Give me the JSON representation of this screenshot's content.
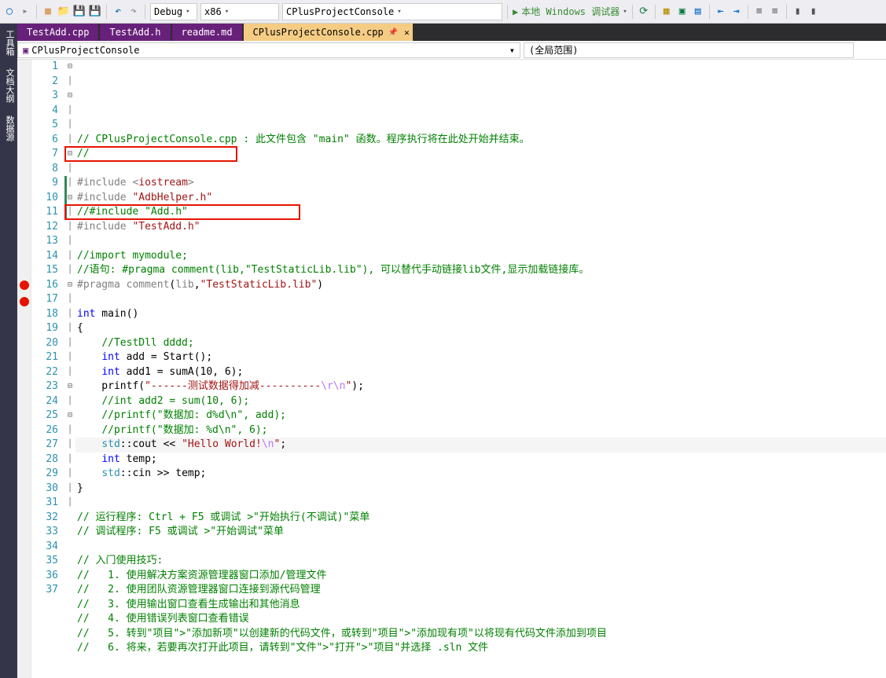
{
  "toolbar": {
    "config": "Debug",
    "platform": "x86",
    "startup": "CPlusProjectConsole",
    "run_label": "本地 Windows 调试器"
  },
  "tabs": [
    {
      "label": "TestAdd.cpp"
    },
    {
      "label": "TestAdd.h"
    },
    {
      "label": "readme.md"
    },
    {
      "label": "CPlusProjectConsole.cpp",
      "active": true
    }
  ],
  "crumb": {
    "file": "CPlusProjectConsole",
    "scope": "(全局范围)"
  },
  "side_tabs": [
    "工具箱",
    "文档大纲",
    "数据源"
  ],
  "lines": [
    {
      "n": 1,
      "fold": "-",
      "html": "<span class='c-comment'>// CPlusProjectConsole.cpp : 此文件包含 \"main\" 函数。程序执行将在此处开始并结束。</span>"
    },
    {
      "n": 2,
      "fold": "|",
      "html": "<span class='c-comment'>//</span>"
    },
    {
      "n": 3,
      "fold": "",
      "html": ""
    },
    {
      "n": 4,
      "fold": "-",
      "html": "<span class='c-grey'>#include</span> <span class='c-grey'>&lt;</span><span class='c-string'>iostream</span><span class='c-grey'>&gt;</span>"
    },
    {
      "n": 5,
      "fold": "|",
      "html": "<span class='c-grey'>#include</span> <span class='c-string'>\"AdbHelper.h\"</span>"
    },
    {
      "n": 6,
      "fold": "|",
      "html": "<span class='c-comment'>//#include \"Add.h\"</span>"
    },
    {
      "n": 7,
      "fold": "|",
      "html": "<span class='c-grey'>#include</span> <span class='c-string'>\"TestAdd.h\"</span>"
    },
    {
      "n": 8,
      "fold": "",
      "html": ""
    },
    {
      "n": 9,
      "fold": "-",
      "gbar": true,
      "html": "<span class='c-comment'>//import mymodule;</span>"
    },
    {
      "n": 10,
      "fold": "|",
      "gbar": true,
      "html": "<span class='c-comment'>//语句: #pragma comment(lib,\"TestStaticLib.lib\"), 可以替代手动链接lib文件,显示加载链接库。</span>"
    },
    {
      "n": 11,
      "fold": "|",
      "gbar": true,
      "html": "<span class='c-grey'>#pragma</span> <span class='c-grey'>comment</span>(<span class='c-grey'>lib</span>,<span class='c-string'>\"TestStaticLib.lib\"</span>)"
    },
    {
      "n": 12,
      "fold": "",
      "html": ""
    },
    {
      "n": 13,
      "fold": "-",
      "html": "<span class='c-keyword'>int</span> main()"
    },
    {
      "n": 14,
      "fold": "|",
      "html": "{"
    },
    {
      "n": 15,
      "fold": "|",
      "html": "    <span class='c-comment'>//TestDll dddd;</span>"
    },
    {
      "n": 16,
      "fold": "|",
      "bp": true,
      "html": "    <span class='c-keyword'>int</span> add = Start();"
    },
    {
      "n": 17,
      "fold": "|",
      "bp": true,
      "html": "    <span class='c-keyword'>int</span> add1 = sumA(10, 6);"
    },
    {
      "n": 18,
      "fold": "|",
      "html": "    printf(<span class='c-string'>\"------测试数据得加减----------</span><span class='c-escape'>\\r\\n</span><span class='c-string'>\"</span>);"
    },
    {
      "n": 19,
      "fold": "-",
      "html": "    <span class='c-comment'>//int add2 = sum(10, 6);</span>"
    },
    {
      "n": 20,
      "fold": "|",
      "html": "    <span class='c-comment'>//printf(\"数据加: d%d\\n\", add);</span>"
    },
    {
      "n": 21,
      "fold": "|",
      "html": "    <span class='c-comment'>//printf(\"数据加: %d\\n\", 6);</span>"
    },
    {
      "n": 22,
      "fold": "|",
      "hl": true,
      "html": "    <span class='c-type'>std</span>::cout &lt;&lt; <span class='c-string'>\"Hello World!</span><span class='c-escape'>\\n</span><span class='c-string'>\"</span>;"
    },
    {
      "n": 23,
      "fold": "|",
      "html": "    <span class='c-keyword'>int</span> temp;"
    },
    {
      "n": 24,
      "fold": "|",
      "html": "    <span class='c-type'>std</span>::cin &gt;&gt; temp;"
    },
    {
      "n": 25,
      "fold": "|",
      "html": "}"
    },
    {
      "n": 26,
      "fold": "",
      "html": ""
    },
    {
      "n": 27,
      "fold": "-",
      "html": "<span class='c-comment'>// 运行程序: Ctrl + F5 或调试 &gt;\"开始执行(不调试)\"菜单</span>"
    },
    {
      "n": 28,
      "fold": "|",
      "html": "<span class='c-comment'>// 调试程序: F5 或调试 &gt;\"开始调试\"菜单</span>"
    },
    {
      "n": 29,
      "fold": "",
      "html": ""
    },
    {
      "n": 30,
      "fold": "-",
      "html": "<span class='c-comment'>// 入门使用技巧: </span>"
    },
    {
      "n": 31,
      "fold": "|",
      "html": "<span class='c-comment'>//   1. 使用解决方案资源管理器窗口添加/管理文件</span>"
    },
    {
      "n": 32,
      "fold": "|",
      "html": "<span class='c-comment'>//   2. 使用团队资源管理器窗口连接到源代码管理</span>"
    },
    {
      "n": 33,
      "fold": "|",
      "html": "<span class='c-comment'>//   3. 使用输出窗口查看生成输出和其他消息</span>"
    },
    {
      "n": 34,
      "fold": "|",
      "html": "<span class='c-comment'>//   4. 使用错误列表窗口查看错误</span>"
    },
    {
      "n": 35,
      "fold": "|",
      "html": "<span class='c-comment'>//   5. 转到\"项目\"&gt;\"添加新项\"以创建新的代码文件，或转到\"项目\"&gt;\"添加现有项\"以将现有代码文件添加到项目</span>"
    },
    {
      "n": 36,
      "fold": "|",
      "html": "<span class='c-comment'>//   6. 将来，若要再次打开此项目，请转到\"文件\"&gt;\"打开\"&gt;\"项目\"并选择 .sln 文件</span>"
    },
    {
      "n": 37,
      "fold": "",
      "html": ""
    }
  ]
}
